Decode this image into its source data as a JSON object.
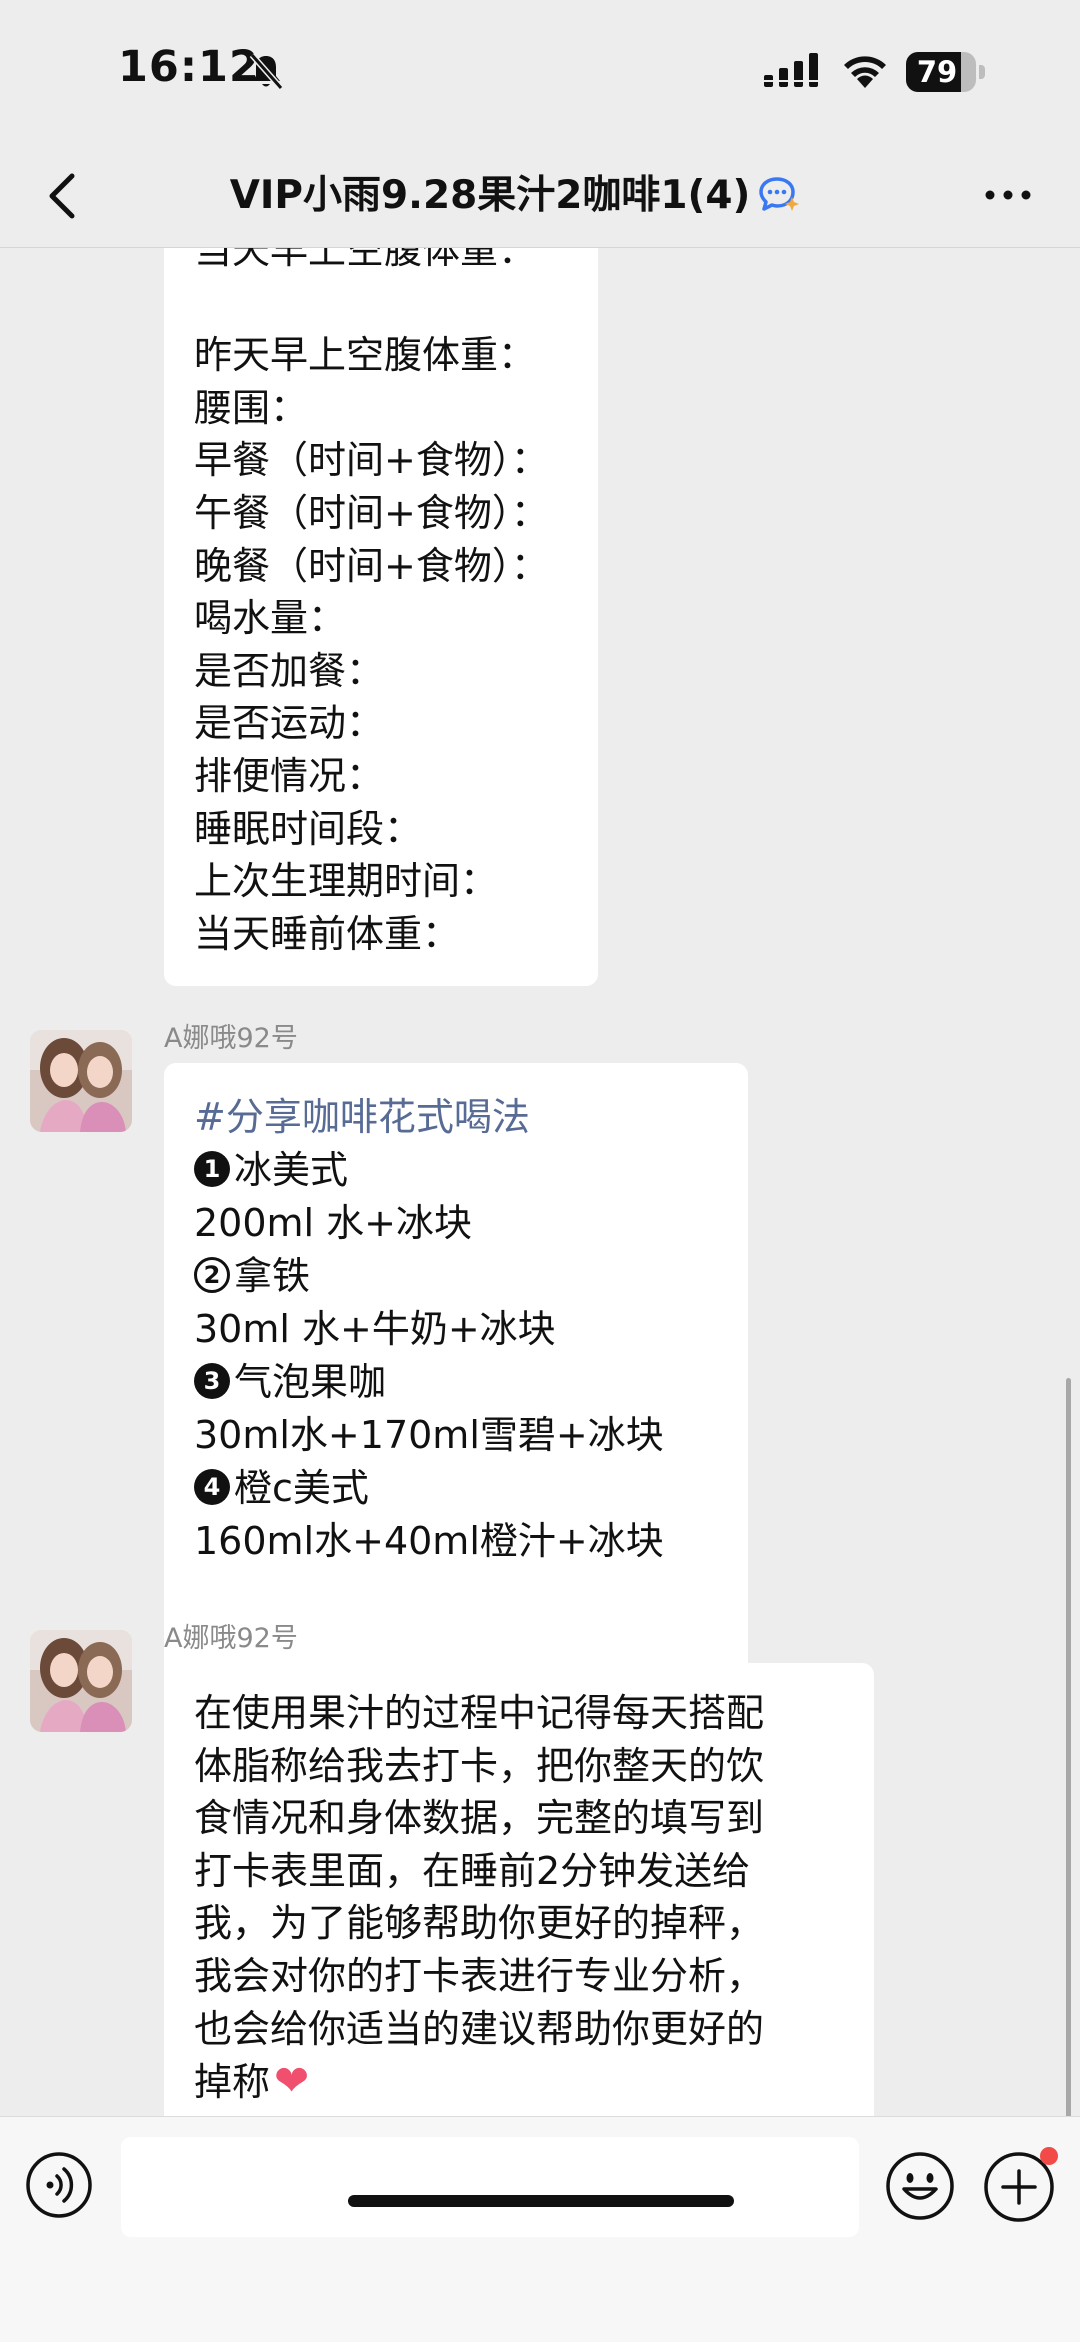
{
  "status_bar": {
    "time": "16:12",
    "battery": "79",
    "battery_level": 0.79
  },
  "header": {
    "title": "VIP小雨9.28果汁2咖啡1(4)"
  },
  "messages": [
    {
      "type": "text",
      "lines": [
        "当天早上空腹体重：",
        "",
        "昨天早上空腹体重：",
        "腰围：",
        "早餐（时间+食物）：",
        "午餐（时间+食物）：",
        "晚餐（时间+食物）：",
        "喝水量：",
        "是否加餐：",
        "是否运动：",
        "排便情况：",
        "睡眠时间段：",
        "上次生理期时间：",
        "当天睡前体重："
      ]
    },
    {
      "sender": "A娜哦92号",
      "hashtag": "#分享咖啡花式喝法",
      "items": [
        {
          "num": "1",
          "name": "冰美式",
          "recipe": "200ml 水+冰块"
        },
        {
          "num": "2",
          "name": "拿铁",
          "recipe": "30ml 水+牛奶+冰块"
        },
        {
          "num": "3",
          "name": "气泡果咖",
          "recipe": "30ml水+170ml雪碧+冰块"
        },
        {
          "num": "4",
          "name": "橙c美式",
          "recipe": "160ml水+40ml橙汁+冰块"
        }
      ]
    },
    {
      "sender": "A娜哦92号",
      "lines": [
        "在使用果汁的过程中记得每天搭配",
        "体脂称给我去打卡，把你整天的饮",
        "食情况和身体数据，完整的填写到",
        "打卡表里面，在睡前2分钟发送给",
        "我，为了能够帮助你更好的掉秤，",
        "我会对你的打卡表进行专业分析，",
        "也会给你适当的建议帮助你更好的",
        "掉称"
      ],
      "emoji": "❤"
    }
  ],
  "input": {
    "placeholder": ""
  },
  "colors": {
    "background": "#ededed",
    "bubble": "#ffffff",
    "hashtag": "#576b95",
    "heart": "#f0506e",
    "badge": "#f24b47"
  }
}
